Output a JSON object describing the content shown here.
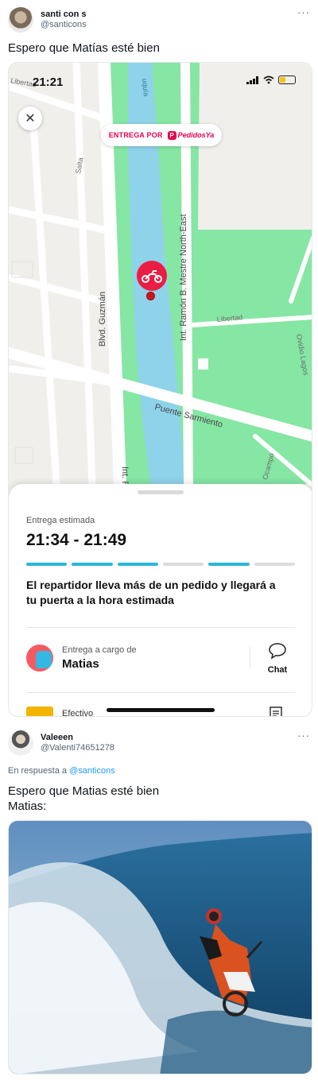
{
  "tweet1": {
    "display_name": "santi con s",
    "handle": "@santicons",
    "more_label": "···",
    "text": "Espero que Matías esté bien",
    "screenshot": {
      "status_time": "21:21",
      "battery_level": 0.4,
      "close_label": "✕",
      "brand_label": "ENTREGA POR",
      "brand_logo": "PedidosYa",
      "brand_color": "#ea004b",
      "map_labels": {
        "libertad_top": "Libertad",
        "salta": "Salta",
        "river": "uquía",
        "mestre": "Int. Ramón B. Mestre North-East",
        "guzman": "Blvd. Guzmán",
        "libertad_right": "Libertad",
        "ovidio": "Ovidio Lagos",
        "sarmiento": "Puente Sarmiento",
        "int_r": "Int. R",
        "ocampo": "Ocampo"
      },
      "sheet": {
        "estimate_label": "Entrega estimada",
        "estimate_time": "21:34 - 21:49",
        "progress_segments": [
          "on",
          "on",
          "on",
          "off",
          "on",
          "off"
        ],
        "message": "El repartidor lleva más de un pedido y llegará a tu puerta a la hora estimada",
        "courier_label": "Entrega a cargo de",
        "courier_name": "Matias",
        "chat_label": "Chat",
        "payment_label": "Efectivo"
      },
      "colors": {
        "park": "#86e6a4",
        "river": "#8fd3ea",
        "road": "#ffffff",
        "land": "#f1efec",
        "accent": "#2bb7da",
        "pin": "#ea1e44"
      }
    }
  },
  "tweet2": {
    "display_name": "Valeeen",
    "handle": "@Valenti74651278",
    "more_label": "···",
    "reply_prefix": "En respuesta a",
    "reply_to": "@santicons",
    "text": "Espero que Matias esté bien\nMatias:",
    "photo_icon": "motocross-rider-surfing-wave"
  }
}
